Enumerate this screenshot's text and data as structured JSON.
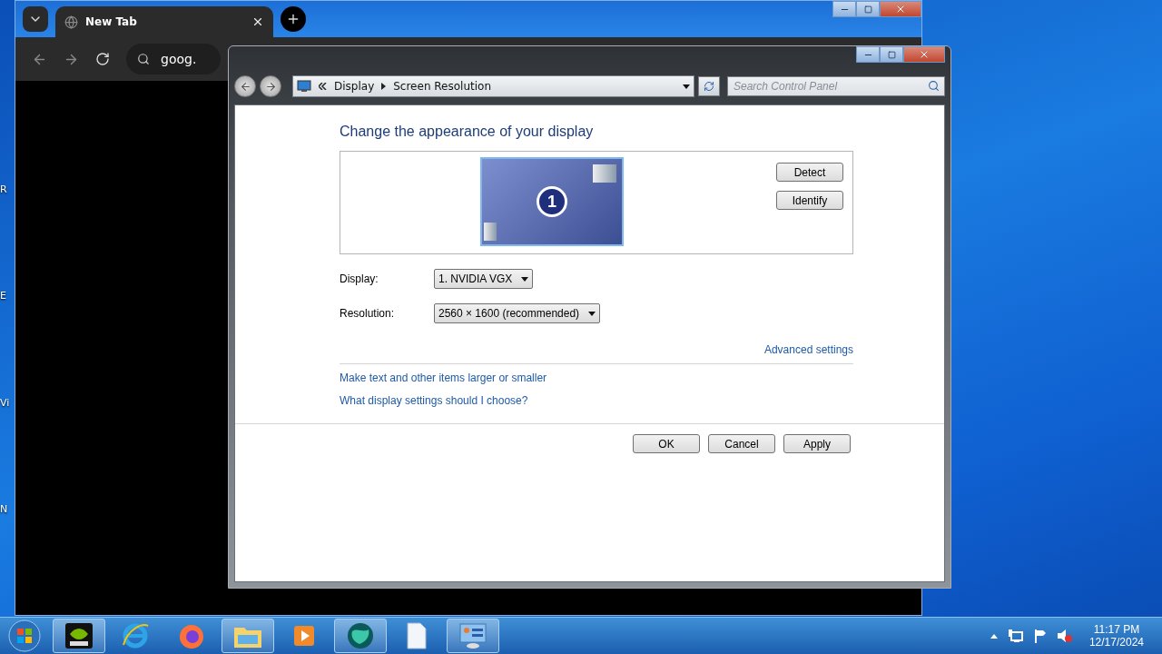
{
  "desktop_icons": [
    {
      "label": "R"
    },
    {
      "label": "E"
    },
    {
      "label": "Vi"
    },
    {
      "label": "N"
    }
  ],
  "browser": {
    "tab": {
      "title": "New Tab"
    },
    "address": {
      "value": "goog."
    }
  },
  "control_panel": {
    "breadcrumb": [
      "Display",
      "Screen Resolution"
    ],
    "search": {
      "placeholder": "Search Control Panel"
    },
    "heading": "Change the appearance of your display",
    "monitor": {
      "number": "1",
      "selected": true
    },
    "side_buttons": [
      "Detect",
      "Identify"
    ],
    "fields": [
      {
        "label": "Display:",
        "value": "1. NVIDIA VGX"
      },
      {
        "label": "Resolution:",
        "value": "2560 × 1600 (recommended)"
      }
    ],
    "advanced_link": "Advanced settings",
    "links": [
      "Make text and other items larger or smaller",
      "What display settings should I choose?"
    ],
    "buttons": [
      "OK",
      "Cancel",
      "Apply"
    ]
  },
  "taskbar": {
    "items": [
      {
        "kind": "nvidia",
        "active": true
      },
      {
        "kind": "browser-e",
        "active": false
      },
      {
        "kind": "firefox",
        "active": false
      },
      {
        "kind": "folder",
        "active": true
      },
      {
        "kind": "media",
        "active": false
      },
      {
        "kind": "globe",
        "active": true
      },
      {
        "kind": "file",
        "active": false
      },
      {
        "kind": "control-panel",
        "active": true
      }
    ],
    "clock": {
      "time": "11:17 PM",
      "date": "12/17/2024"
    }
  }
}
